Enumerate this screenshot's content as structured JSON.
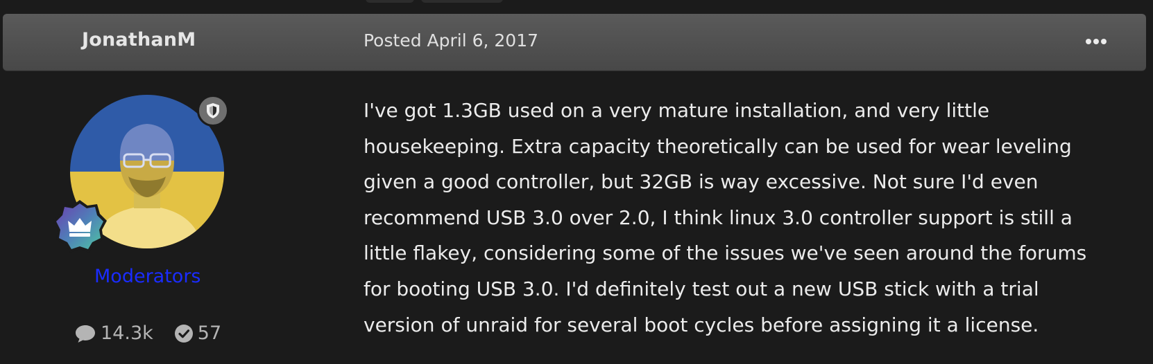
{
  "post": {
    "author": "JonathanM",
    "posted": "Posted April 6, 2017",
    "group": "Moderators",
    "stats": {
      "posts": "14.3k",
      "reputation": "57"
    },
    "body_lines": [
      "I've got 1.3GB used on a very mature installation, and very little",
      "housekeeping. Extra capacity theoretically can be used for wear leveling",
      "given a good controller, but 32GB is way excessive. Not sure I'd even",
      "recommend USB 3.0 over 2.0, I think linux 3.0 controller support is still a",
      "little flakey, considering some of the issues we've seen around the forums",
      "for booting USB 3.0. I'd definitely test out a new USB stick with a trial",
      "version of unraid for several boot cycles before assigning it a license."
    ]
  },
  "icons": {
    "menu": "ellipsis-icon",
    "moderator_badge": "shield-icon",
    "rank_badge": "crown-icon",
    "posts": "comment-icon",
    "reputation": "check-circle-icon"
  },
  "colors": {
    "background": "#1b1b1b",
    "header": "#525252",
    "group_link": "#1a2cff",
    "avatar_blue": "#2f5ba8",
    "avatar_yellow": "#e3c244"
  }
}
